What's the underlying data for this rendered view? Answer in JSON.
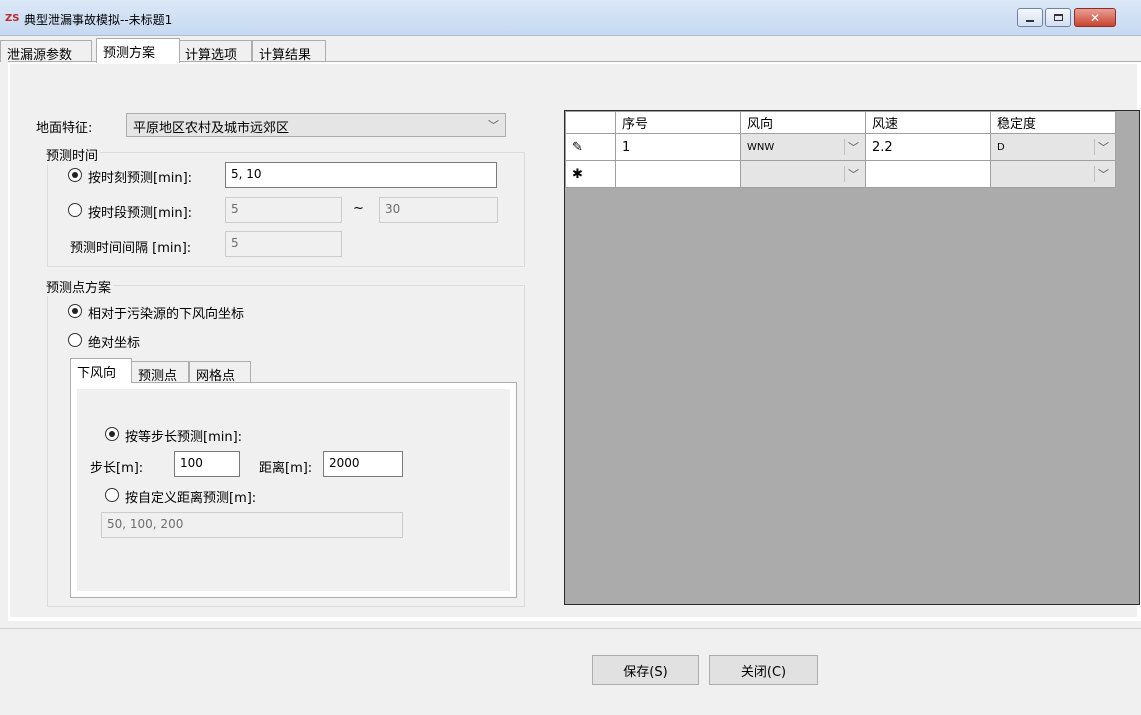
{
  "window": {
    "title": "典型泄漏事故模拟--未标题1",
    "app_icon_text": "ZS"
  },
  "tabs": [
    "泄漏源参数",
    "预测方案",
    "计算选项",
    "计算结果"
  ],
  "ground": {
    "label": "地面特征:",
    "value": "平原地区农村及城市远郊区"
  },
  "time": {
    "group_title": "预测时间",
    "by_moment_label": "按时刻预测[min]:",
    "by_moment_value": "5, 10",
    "by_period_label": "按时段预测[min]:",
    "period_from": "5",
    "tilde": "~",
    "period_to": "30",
    "interval_label": "预测时间间隔 [min]:",
    "interval_value": "5"
  },
  "points": {
    "group_title": "预测点方案",
    "relative_label": "相对于污染源的下风向坐标",
    "absolute_label": "绝对坐标",
    "subtabs": [
      "下风向",
      "预测点",
      "网格点"
    ],
    "equal_step_label": "按等步长预测[min]:",
    "step_label": "步长[m]:",
    "step_value": "100",
    "distance_label": "距离[m]:",
    "distance_value": "2000",
    "custom_label": "按自定义距离预测[m]:",
    "custom_value": "50, 100, 200"
  },
  "grid": {
    "headers": [
      "序号",
      "风向",
      "风速",
      "稳定度"
    ],
    "rows": [
      {
        "marker": "✎",
        "index": "1",
        "direction": "WNW",
        "speed": "2.2",
        "stability": "D"
      },
      {
        "marker": "✱",
        "index": "",
        "direction": "",
        "speed": "",
        "stability": ""
      }
    ]
  },
  "buttons": {
    "save": "保存(S)",
    "close": "关闭(C)"
  }
}
